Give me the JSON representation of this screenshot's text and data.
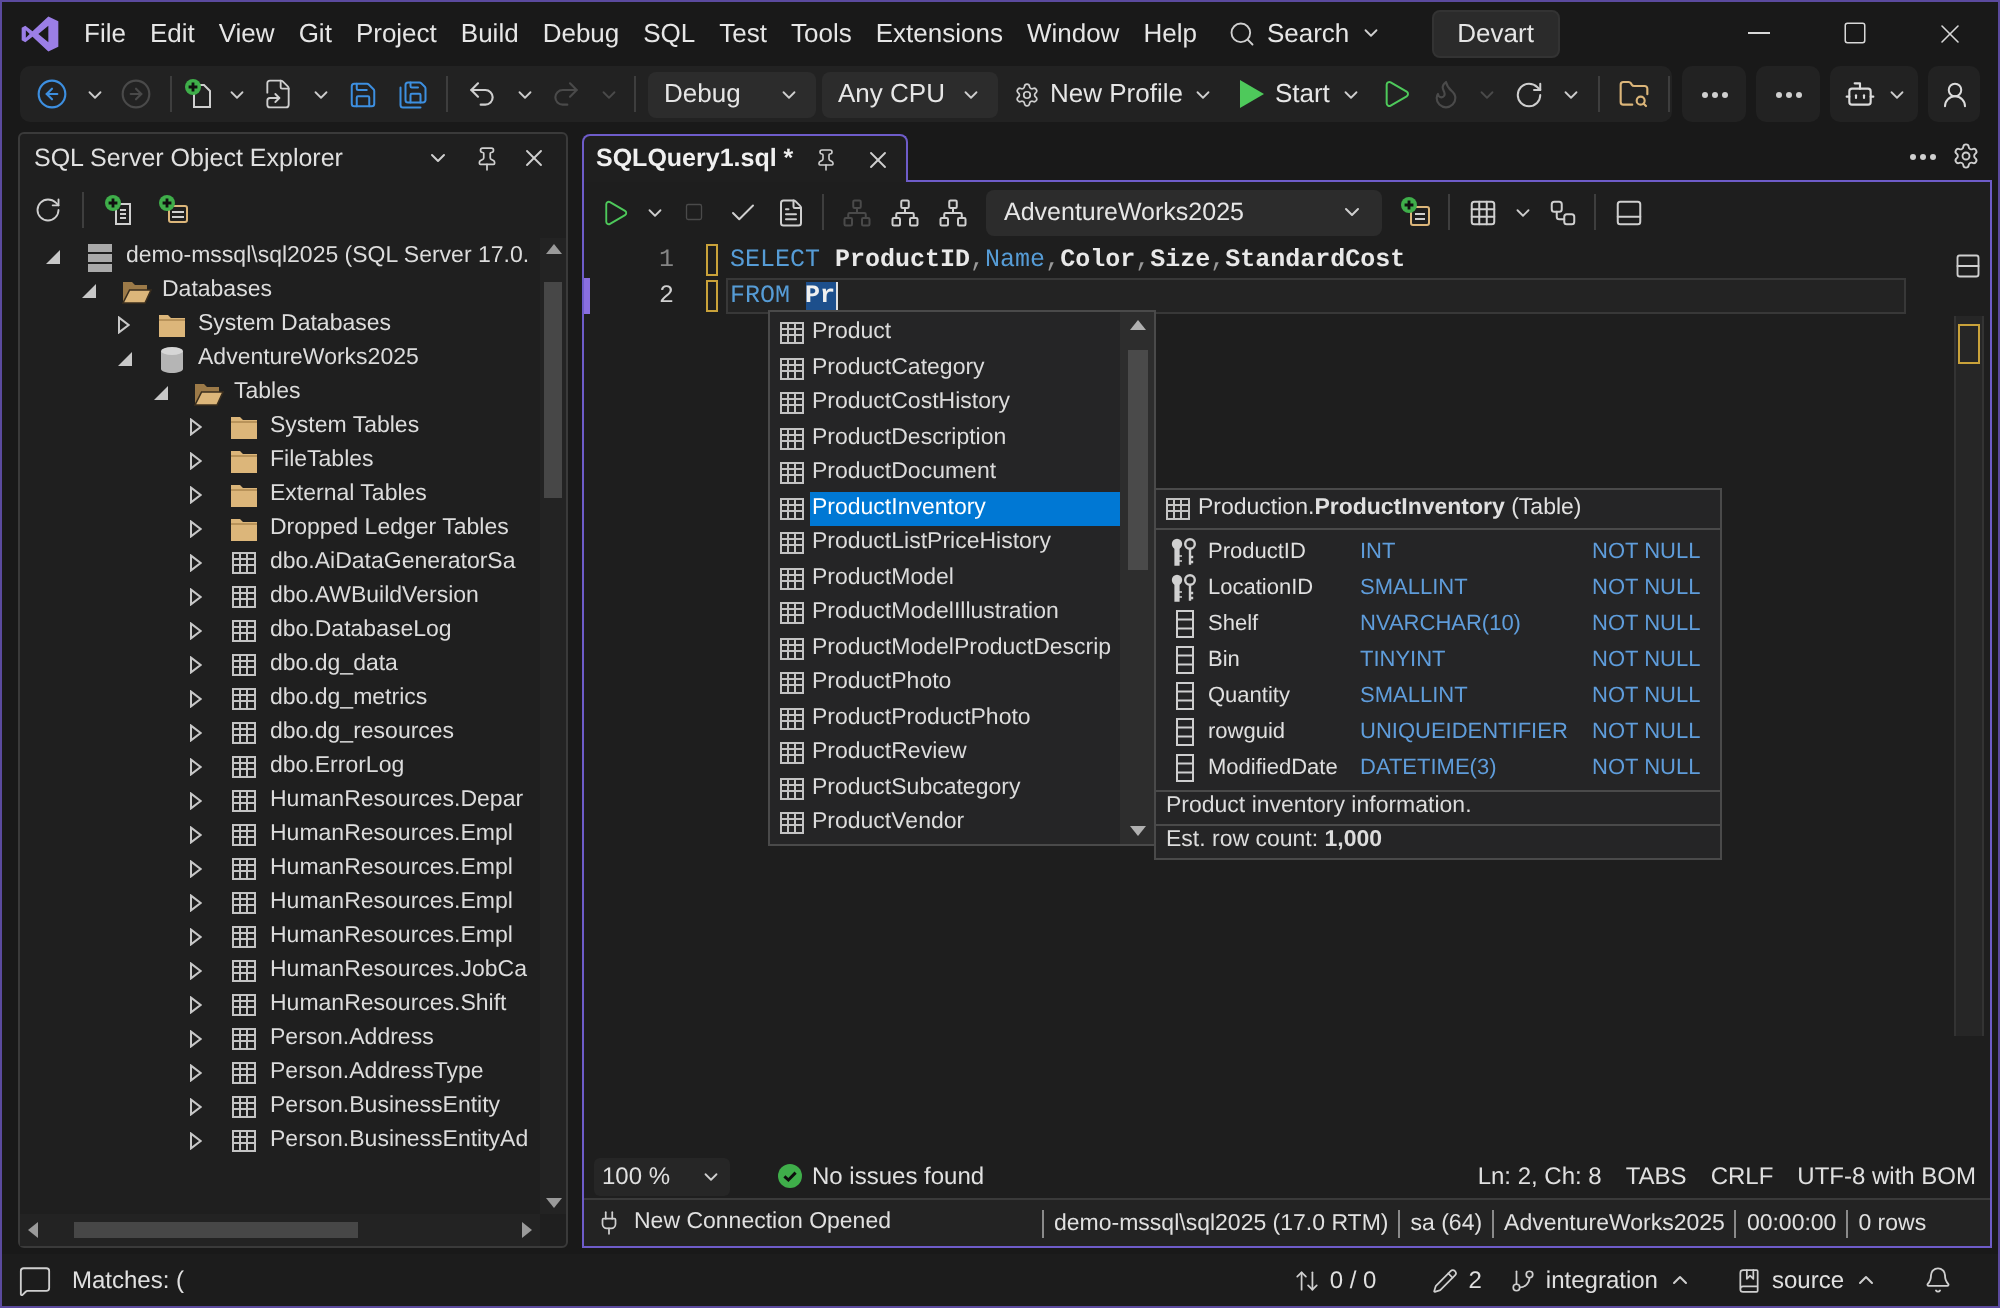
{
  "title_bar": {
    "menu": [
      "File",
      "Edit",
      "View",
      "Git",
      "Project",
      "Build",
      "Debug",
      "SQL",
      "Test",
      "Tools",
      "Extensions",
      "Window",
      "Help"
    ],
    "search": "Search",
    "account": "Devart"
  },
  "toolbar": {
    "configuration": "Debug",
    "platform": "Any CPU",
    "profile": "New Profile",
    "start": "Start"
  },
  "explorer": {
    "title": "SQL Server Object Explorer",
    "tree": [
      {
        "label": "demo-mssql\\sql2025 (SQL Server 17.0.",
        "kind": "server",
        "expanded": true,
        "children": [
          {
            "label": "Databases",
            "kind": "folder",
            "expanded": true,
            "children": [
              {
                "label": "System Databases",
                "kind": "folder",
                "expanded": false
              },
              {
                "label": "AdventureWorks2025",
                "kind": "database",
                "expanded": true,
                "children": [
                  {
                    "label": "Tables",
                    "kind": "folder",
                    "expanded": true,
                    "children": [
                      {
                        "label": "System Tables",
                        "kind": "folder",
                        "expanded": false
                      },
                      {
                        "label": "FileTables",
                        "kind": "folder",
                        "expanded": false
                      },
                      {
                        "label": "External Tables",
                        "kind": "folder",
                        "expanded": false
                      },
                      {
                        "label": "Dropped Ledger Tables",
                        "kind": "folder",
                        "expanded": false
                      },
                      {
                        "label": "dbo.AiDataGeneratorSa",
                        "kind": "table",
                        "expanded": false
                      },
                      {
                        "label": "dbo.AWBuildVersion",
                        "kind": "table",
                        "expanded": false
                      },
                      {
                        "label": "dbo.DatabaseLog",
                        "kind": "table",
                        "expanded": false
                      },
                      {
                        "label": "dbo.dg_data",
                        "kind": "table",
                        "expanded": false
                      },
                      {
                        "label": "dbo.dg_metrics",
                        "kind": "table",
                        "expanded": false
                      },
                      {
                        "label": "dbo.dg_resources",
                        "kind": "table",
                        "expanded": false
                      },
                      {
                        "label": "dbo.ErrorLog",
                        "kind": "table",
                        "expanded": false
                      },
                      {
                        "label": "HumanResources.Depar",
                        "kind": "table",
                        "expanded": false
                      },
                      {
                        "label": "HumanResources.Empl",
                        "kind": "table",
                        "expanded": false
                      },
                      {
                        "label": "HumanResources.Empl",
                        "kind": "table",
                        "expanded": false
                      },
                      {
                        "label": "HumanResources.Empl",
                        "kind": "table",
                        "expanded": false
                      },
                      {
                        "label": "HumanResources.Empl",
                        "kind": "table",
                        "expanded": false
                      },
                      {
                        "label": "HumanResources.JobCa",
                        "kind": "table",
                        "expanded": false
                      },
                      {
                        "label": "HumanResources.Shift",
                        "kind": "table",
                        "expanded": false
                      },
                      {
                        "label": "Person.Address",
                        "kind": "table",
                        "expanded": false
                      },
                      {
                        "label": "Person.AddressType",
                        "kind": "table",
                        "expanded": false
                      },
                      {
                        "label": "Person.BusinessEntity",
                        "kind": "table",
                        "expanded": false
                      },
                      {
                        "label": "Person.BusinessEntityAd",
                        "kind": "table",
                        "expanded": false
                      }
                    ]
                  }
                ]
              }
            ]
          }
        ]
      }
    ]
  },
  "editor": {
    "tab": {
      "title": "SQLQuery1.sql *",
      "selected": true
    },
    "database": "AdventureWorks2025",
    "lines": [
      {
        "number": "1",
        "current": false,
        "modified": true,
        "tokens": [
          {
            "text": "SELECT ",
            "kind": "keyword"
          },
          {
            "text": "ProductID",
            "kind": "identifier"
          },
          {
            "text": ",",
            "kind": "punctuation"
          },
          {
            "text": "Name",
            "kind": "keyword"
          },
          {
            "text": ",",
            "kind": "punctuation"
          },
          {
            "text": "Color",
            "kind": "identifier"
          },
          {
            "text": ",",
            "kind": "punctuation"
          },
          {
            "text": "Size",
            "kind": "identifier"
          },
          {
            "text": ",",
            "kind": "punctuation"
          },
          {
            "text": "StandardCost",
            "kind": "identifier"
          }
        ]
      },
      {
        "number": "2",
        "current": true,
        "modified": true,
        "tokens": [
          {
            "text": "FROM ",
            "kind": "keyword"
          },
          {
            "text": "Pr",
            "kind": "match"
          }
        ]
      }
    ],
    "completion": {
      "items": [
        {
          "label": "Product",
          "selected": false
        },
        {
          "label": "ProductCategory",
          "selected": false
        },
        {
          "label": "ProductCostHistory",
          "selected": false
        },
        {
          "label": "ProductDescription",
          "selected": false
        },
        {
          "label": "ProductDocument",
          "selected": false
        },
        {
          "label": "ProductInventory",
          "selected": true
        },
        {
          "label": "ProductListPriceHistory",
          "selected": false
        },
        {
          "label": "ProductModel",
          "selected": false
        },
        {
          "label": "ProductModelIllustration",
          "selected": false
        },
        {
          "label": "ProductModelProductDescrip",
          "selected": false
        },
        {
          "label": "ProductPhoto",
          "selected": false
        },
        {
          "label": "ProductProductPhoto",
          "selected": false
        },
        {
          "label": "ProductReview",
          "selected": false
        },
        {
          "label": "ProductSubcategory",
          "selected": false
        },
        {
          "label": "ProductVendor",
          "selected": false
        }
      ]
    },
    "tooltip": {
      "title": "Production.**ProductInventory** (Table)",
      "columns": [
        {
          "name": "ProductID",
          "type": "INT",
          "nullability": "NOT NULL",
          "kind": "key"
        },
        {
          "name": "LocationID",
          "type": "SMALLINT",
          "nullability": "NOT NULL",
          "kind": "key"
        },
        {
          "name": "Shelf",
          "type": "NVARCHAR(10)",
          "nullability": "NOT NULL",
          "kind": "column"
        },
        {
          "name": "Bin",
          "type": "TINYINT",
          "nullability": "NOT NULL",
          "kind": "column"
        },
        {
          "name": "Quantity",
          "type": "SMALLINT",
          "nullability": "NOT NULL",
          "kind": "column"
        },
        {
          "name": "rowguid",
          "type": "UNIQUEIDENTIFIER",
          "nullability": "NOT NULL",
          "kind": "column"
        },
        {
          "name": "ModifiedDate",
          "type": "DATETIME(3)",
          "nullability": "NOT NULL",
          "kind": "column"
        }
      ],
      "description": "Product inventory information.",
      "row_count": "Est. row count: **1,000**"
    },
    "status": {
      "zoom": "100 %",
      "issues": "No issues found",
      "position": "Ln: 2, Ch: 8",
      "indentation": "TABS",
      "line_endings": "CRLF",
      "encoding": "UTF-8 with BOM"
    },
    "connection": {
      "message": "New Connection Opened",
      "server": "demo-mssql\\sql2025 (17.0 RTM)",
      "user": "sa (64)",
      "database": "AdventureWorks2025",
      "elapsed": "00:00:00",
      "rows": "0 rows"
    }
  },
  "status_bar": {
    "matches": "Matches: (",
    "errors": "0 / 0",
    "changes": "2",
    "branch": "integration",
    "repository": "source"
  }
}
